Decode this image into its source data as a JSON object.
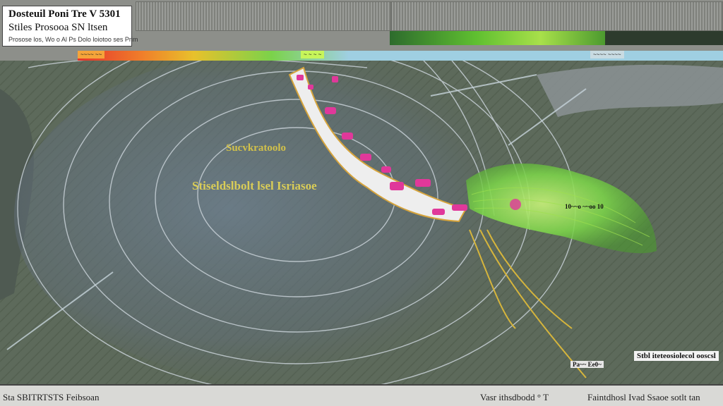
{
  "title_box": {
    "line1": "Dosteuil Poni Tre V 5301",
    "line2": "Stiles Prosooa SN ltsen",
    "line3": "Prosose los, Wo o Al Ps Dolo loiotoo ses  Prim"
  },
  "color_scale": {
    "label_left": "~~~~ ~~",
    "label_mid": "~ ~ ~ ~",
    "label_right": "~~~~ ~~~~"
  },
  "map_labels": {
    "upper": "Sucvkratoolo",
    "lower": "Stiseldslbolt lsel  Isriasoe",
    "green_region": "10~~o ~~oo 10",
    "right": "Stbl iteteosiolecol ooscsl",
    "bottom": "Pa~~ Ee0~"
  },
  "status_bar": {
    "left": "Sta  SBITRTSTS Feibsoan",
    "mid": "Vasr ithsdbodd  ° T",
    "right": "Faintdhosl Ivad   Ssaoe sotlt tan"
  },
  "colors": {
    "background": "#5a6358",
    "plume_green": "#7bd24a",
    "track_white": "#eeeeee",
    "marker_pink": "#e0389a",
    "contour": "#c7d0d6",
    "label_yellow": "#d9cc57"
  }
}
